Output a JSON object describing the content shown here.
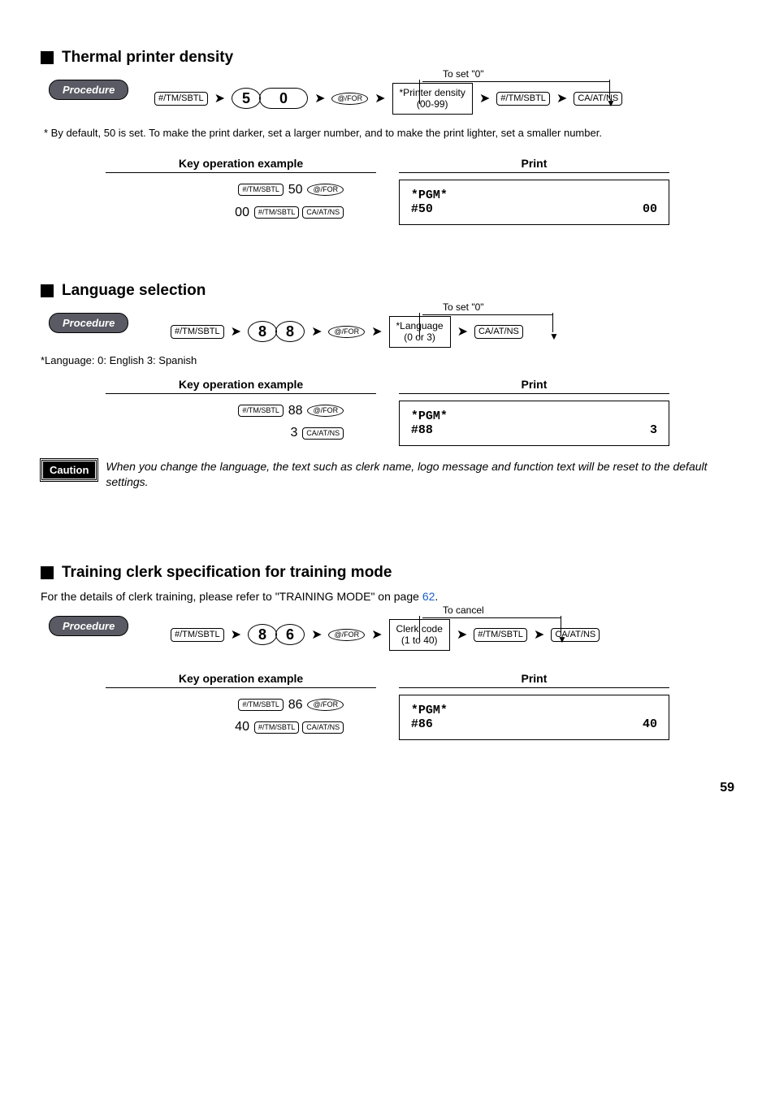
{
  "section1": {
    "title": "Thermal printer density",
    "procedure_label": "Procedure",
    "bypass_label": "To set \"0\"",
    "flow": {
      "k1": "#/TM/SBTL",
      "d1": "5",
      "d2": "0",
      "k2": "@/FOR",
      "param_top": "*Printer density",
      "param_bot": "(00-99)",
      "k3": "#/TM/SBTL",
      "k4": "CA/AT/NS"
    },
    "note": "* By default, 50 is set.  To make the print darker, set a larger number, and to make the print lighter, set a smaller number.",
    "example": {
      "key_header": "Key operation example",
      "print_header": "Print",
      "line1_k1": "#/TM/SBTL",
      "line1_num": "50",
      "line1_k2": "@/FOR",
      "line2_num": "00",
      "line2_k1": "#/TM/SBTL",
      "line2_k2": "CA/AT/NS",
      "print_left_top": "*PGM*",
      "print_left_bot": "#50",
      "print_right": "00"
    }
  },
  "section2": {
    "title": "Language selection",
    "procedure_label": "Procedure",
    "bypass_label": "To set \"0\"",
    "flow": {
      "k1": "#/TM/SBTL",
      "d1": "8",
      "d2": "8",
      "k2": "@/FOR",
      "param_top": "*Language",
      "param_bot": "(0 or 3)",
      "k4": "CA/AT/NS"
    },
    "lang_note": "*Language: 0: English      3: Spanish",
    "example": {
      "key_header": "Key operation example",
      "print_header": "Print",
      "line1_k1": "#/TM/SBTL",
      "line1_num": "88",
      "line1_k2": "@/FOR",
      "line2_num": "3",
      "line2_k2": "CA/AT/NS",
      "print_left_top": "*PGM*",
      "print_left_bot": "#88",
      "print_right": "3"
    },
    "caution_label": "Caution",
    "caution_text": "When you change the language, the text such as clerk name, logo message and function text will be reset to the default settings."
  },
  "section3": {
    "title": "Training clerk specification for training mode",
    "sub_note_pre": "For the details of clerk training, please refer to \"TRAINING MODE\" on page ",
    "sub_note_link": "62",
    "sub_note_post": ".",
    "procedure_label": "Procedure",
    "bypass_label": "To cancel",
    "flow": {
      "k1": "#/TM/SBTL",
      "d1": "8",
      "d2": "6",
      "k2": "@/FOR",
      "param_top": "Clerk code",
      "param_bot": "(1 to 40)",
      "k3": "#/TM/SBTL",
      "k4": "CA/AT/NS"
    },
    "example": {
      "key_header": "Key operation example",
      "print_header": "Print",
      "line1_k1": "#/TM/SBTL",
      "line1_num": "86",
      "line1_k2": "@/FOR",
      "line2_num": "40",
      "line2_k1": "#/TM/SBTL",
      "line2_k2": "CA/AT/NS",
      "print_left_top": "*PGM*",
      "print_left_bot": "#86",
      "print_right": "40"
    }
  },
  "page_number": "59"
}
